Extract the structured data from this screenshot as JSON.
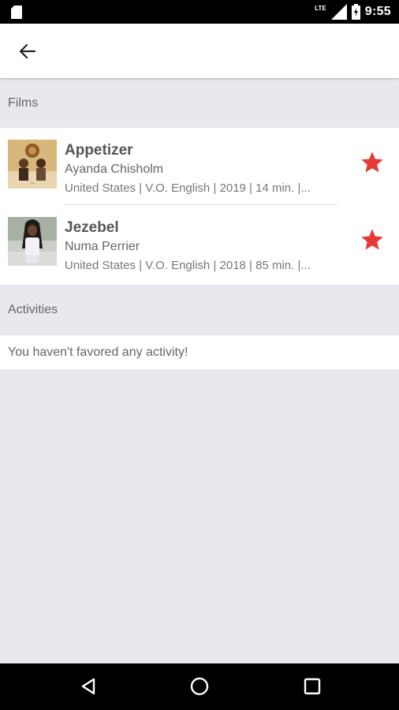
{
  "status_bar": {
    "network": "LTE",
    "time": "9:55",
    "icons": [
      "sd-card-icon",
      "signal-icon",
      "battery-icon"
    ]
  },
  "app_bar": {
    "back_icon": "arrow-left-icon"
  },
  "sections": {
    "films_label": "Films",
    "activities_label": "Activities"
  },
  "films": [
    {
      "title": "Appetizer",
      "director": "Ayanda Chisholm",
      "meta": "United States | V.O. English | 2019 | 14 min. |...",
      "favorite": true
    },
    {
      "title": "Jezebel",
      "director": "Numa Perrier",
      "meta": "United States | V.O. English | 2018 | 85 min. |...",
      "favorite": true
    }
  ],
  "activities": {
    "empty_message": "You haven't favored any activity!"
  },
  "colors": {
    "accent_star": "#e53935",
    "background": "#e8e8ee",
    "status_bar": "#000000"
  },
  "nav_bar": {
    "icons": [
      "triangle-back-icon",
      "circle-home-icon",
      "square-recents-icon"
    ]
  }
}
